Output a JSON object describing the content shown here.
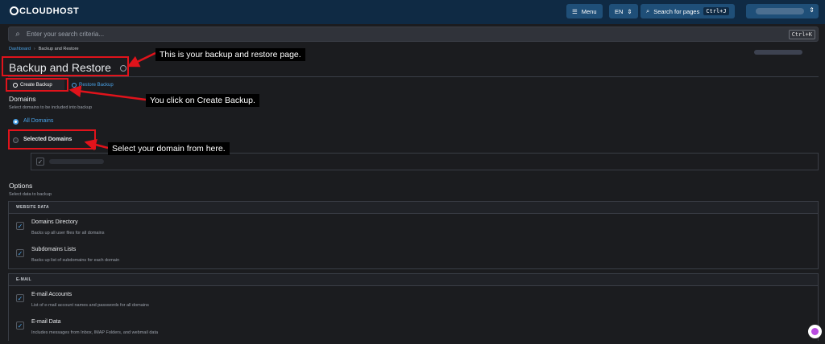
{
  "app": {
    "logo": "CLOUDHOST"
  },
  "topbar": {
    "menu_label": "Menu",
    "lang_label": "EN",
    "search_pages_label": "Search for pages",
    "search_pages_shortcut": "Ctrl+J"
  },
  "search": {
    "placeholder": "Enter your search criteria...",
    "shortcut": "Ctrl+K"
  },
  "breadcrumb": {
    "home": "Dashboard",
    "current": "Backup and Restore"
  },
  "page": {
    "title": "Backup and Restore"
  },
  "tabs": [
    {
      "label": "Create Backup",
      "active": true
    },
    {
      "label": "Restore Backup",
      "active": false
    }
  ],
  "domains": {
    "title": "Domains",
    "subtitle": "Select domains to be included into backup",
    "all_label": "All Domains",
    "selected_label": "Selected Domains"
  },
  "options": {
    "title": "Options",
    "subtitle": "Select data to backup",
    "groups": [
      {
        "header": "WEBSITE DATA",
        "items": [
          {
            "title": "Domains Directory",
            "desc": "Backs up all user files for all domains"
          },
          {
            "title": "Subdomains Lists",
            "desc": "Backs up list of subdomains for each domain"
          }
        ]
      },
      {
        "header": "E-MAIL",
        "items": [
          {
            "title": "E-mail Accounts",
            "desc": "List of e-mail account names and passwords for all domains"
          },
          {
            "title": "E-mail Data",
            "desc": "Includes messages from Inbox, IMAP Folders, and webmail data"
          }
        ]
      }
    ]
  },
  "annotations": {
    "page_note": "This is your backup and restore page.",
    "create_note": "You click on Create Backup.",
    "domain_note": "Select your domain from here."
  },
  "colors": {
    "accent": "#4aa3e8",
    "annotation": "#e0131b",
    "topbar": "#0f2a44"
  }
}
